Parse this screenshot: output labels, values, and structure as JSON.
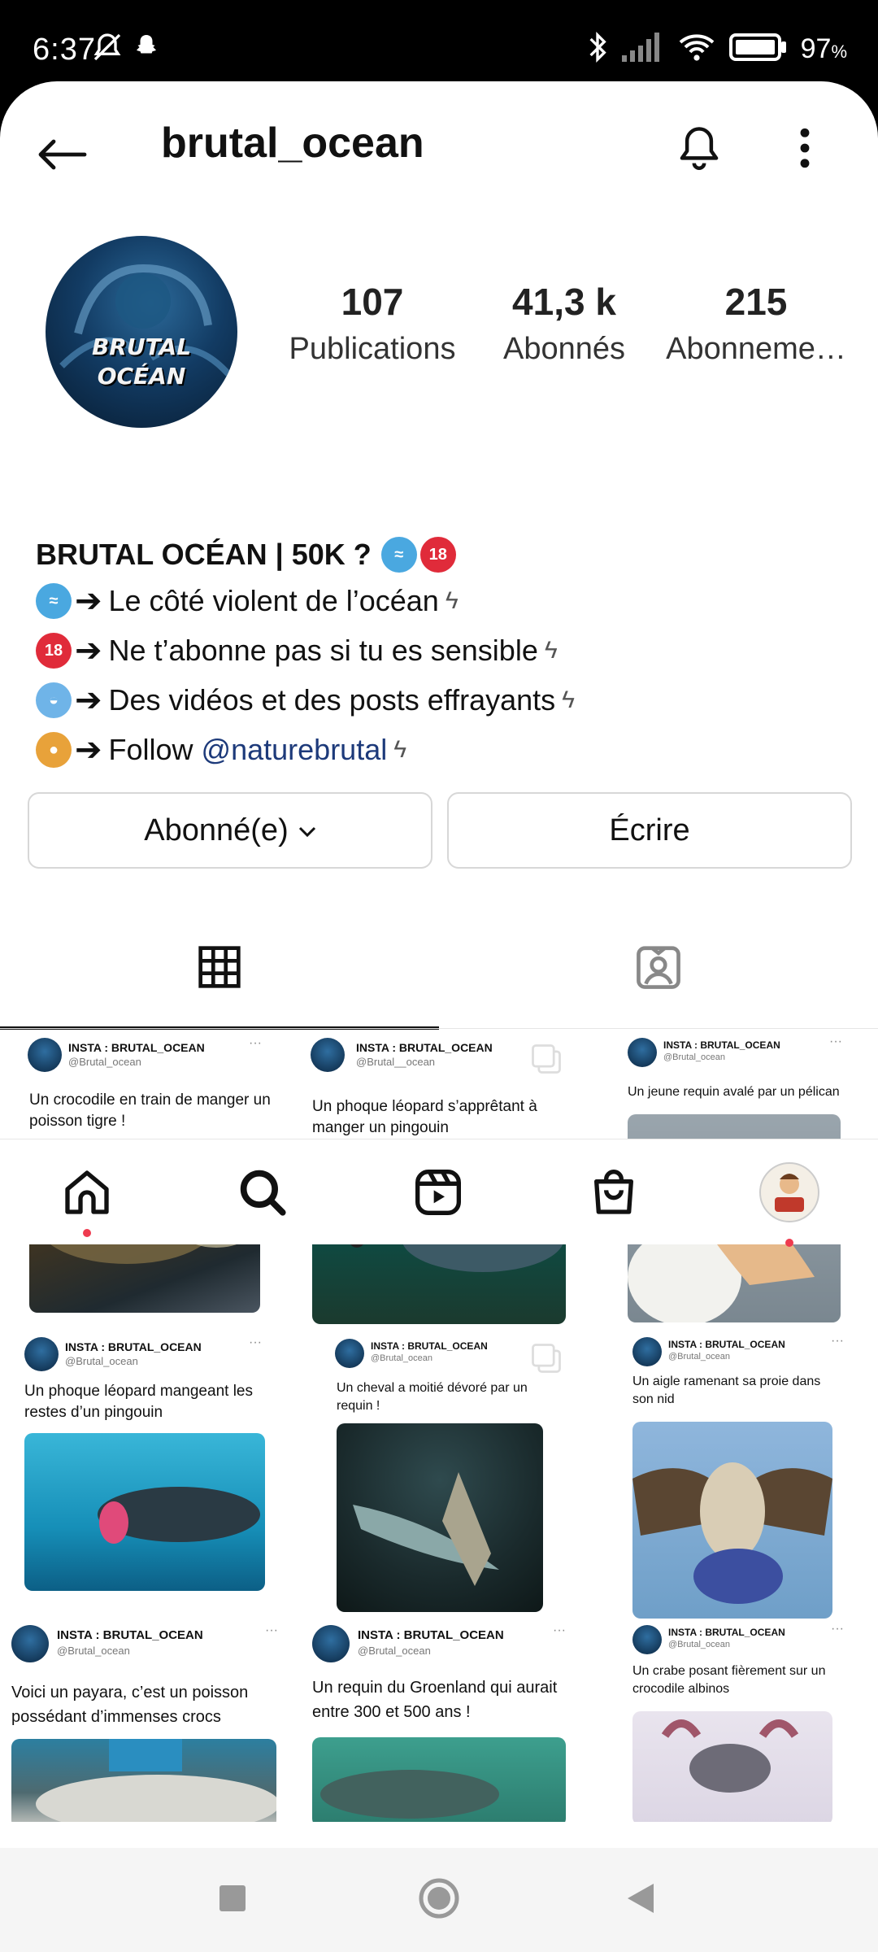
{
  "status_bar": {
    "time": "6:37",
    "battery": "97",
    "battery_unit": "%"
  },
  "header": {
    "username": "brutal_ocean"
  },
  "profile": {
    "avatar_text_1": "BRUTAL",
    "avatar_text_2": "OCÉAN",
    "stats": [
      {
        "value": "107",
        "label": "Publications"
      },
      {
        "value": "41,3 k",
        "label": "Abonnés"
      },
      {
        "value": "215",
        "label": "Abonneme…"
      }
    ],
    "bio_name": "BRUTAL OCÉAN | 50K ?",
    "bio_lines": [
      {
        "text": "Le côté violent de l’océan"
      },
      {
        "text": "Ne t’abonne pas si tu es sensible"
      },
      {
        "text": "Des vidéos et des posts effrayants"
      },
      {
        "text": "Follow",
        "link": "@naturebrutal"
      }
    ],
    "emoji_18": "18"
  },
  "buttons": {
    "following": "Abonné(e)",
    "message": "Écrire"
  },
  "posts": [
    {
      "name": "INSTA : BRUTAL_OCEAN",
      "handle": "@Brutal_ocean",
      "text": "Un crocodile en train de manger un poisson tigre !"
    },
    {
      "name": "INSTA : BRUTAL_OCEAN",
      "handle": "@Brutal__ocean",
      "text": "Un phoque léopard s’apprêtant à manger un pingouin"
    },
    {
      "name": "INSTA : BRUTAL_OCEAN",
      "handle": "@Brutal_ocean",
      "text": "Un jeune requin avalé par un pélican"
    },
    {
      "name": "INSTA : BRUTAL_OCEAN",
      "handle": "@Brutal_ocean",
      "text": "Un phoque léopard mangeant les restes d’un pingouin"
    },
    {
      "name": "INSTA : BRUTAL_OCEAN",
      "handle": "@Brutal_ocean",
      "text": "Un cheval a moitié dévoré par un requin !"
    },
    {
      "name": "INSTA : BRUTAL_OCEAN",
      "handle": "@Brutal_ocean",
      "text": "Un aigle ramenant sa proie dans son nid"
    },
    {
      "name": "INSTA : BRUTAL_OCEAN",
      "handle": "@Brutal_ocean",
      "text": "Voici un payara, c’est un poisson possédant d’immenses crocs"
    },
    {
      "name": "INSTA : BRUTAL_OCEAN",
      "handle": "@Brutal_ocean",
      "text": "Un requin du Groenland qui aurait entre 300 et 500 ans !"
    },
    {
      "name": "INSTA : BRUTAL_OCEAN",
      "handle": "@Brutal_ocean",
      "text": "Un crabe posant fièrement sur un crocodile albinos"
    }
  ],
  "colors": {
    "accent_link": "#1d3a7a",
    "notification_dot": "#ee3b4f"
  }
}
